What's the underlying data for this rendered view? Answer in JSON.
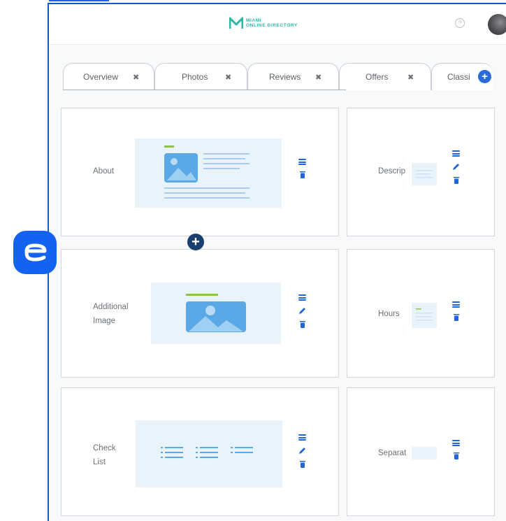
{
  "header": {
    "logo_letter": "M",
    "logo_line1": "MIAMI",
    "logo_line2": "ONLINE DIRECTORY",
    "help_symbol": "?"
  },
  "tabs": [
    {
      "label": "Overview",
      "close": "✖"
    },
    {
      "label": "Photos",
      "close": "✖"
    },
    {
      "label": "Reviews",
      "close": "✖"
    },
    {
      "label": "Offers",
      "close": "✖"
    },
    {
      "label": "Classi",
      "close": ""
    }
  ],
  "tab_add_symbol": "+",
  "float_add_symbol": "+",
  "cards": {
    "about": {
      "label": "About"
    },
    "description": {
      "label": "Descrip"
    },
    "additional_image": {
      "label_line1": "Additional",
      "label_line2": "Image"
    },
    "hours": {
      "label": "Hours"
    },
    "check_list": {
      "label_line1": "Check",
      "label_line2": "List"
    },
    "separator": {
      "label": "Separat"
    }
  },
  "colors": {
    "accent_blue": "#1f66d6",
    "thumb_bg": "#e9f3fc",
    "brand_teal": "#2bb7a3",
    "badge_blue": "#1363f0"
  },
  "icons": [
    "help-icon",
    "avatar",
    "close-icon",
    "plus-icon",
    "menu-icon",
    "pencil-icon",
    "trash-icon",
    "image-icon",
    "brand-e-icon"
  ]
}
